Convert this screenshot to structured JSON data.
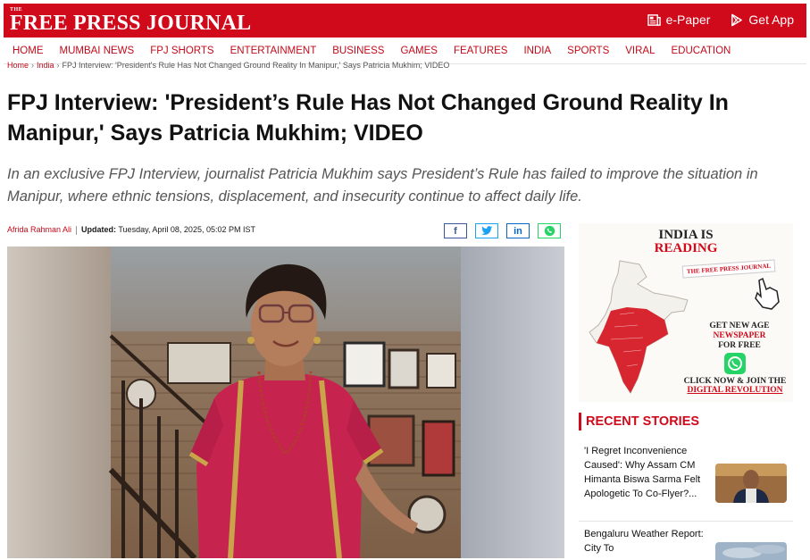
{
  "header": {
    "logo_the": "THE",
    "logo_name": "FREE PRESS JOURNAL",
    "epaper_label": "e-Paper",
    "getapp_label": "Get App"
  },
  "nav": {
    "items": [
      "HOME",
      "MUMBAI NEWS",
      "FPJ SHORTS",
      "ENTERTAINMENT",
      "BUSINESS",
      "GAMES",
      "FEATURES",
      "INDIA",
      "SPORTS",
      "VIRAL",
      "EDUCATION"
    ]
  },
  "breadcrumb": {
    "items": [
      "Home",
      "India",
      "FPJ Interview: 'President's Rule Has Not Changed Ground Reality In Manipur,' Says Patricia Mukhim; VIDEO"
    ]
  },
  "article": {
    "headline": "FPJ Interview: 'President’s Rule Has Not Changed Ground Reality In Manipur,' Says Patricia Mukhim; VIDEO",
    "summary": "In an exclusive FPJ Interview, journalist Patricia Mukhim says President’s Rule has failed to improve the situation in Manipur, where ethnic tensions, displacement, and insecurity continue to affect daily life.",
    "author": "Afrida Rahman Ali",
    "updated_label": "Updated:",
    "updated_value": "Tuesday, April 08, 2025, 05:02 PM IST"
  },
  "share": {
    "facebook": "f",
    "twitter": "twitter-bird-icon",
    "linkedin": "in",
    "whatsapp": "whatsapp-icon"
  },
  "ad": {
    "title_line1": "INDIA IS",
    "title_line2": "READING",
    "paper_name": "THE FREE PRESS JOURNAL",
    "line_get": "GET NEW AGE",
    "line_newspaper": "NEWSPAPER",
    "line_free": "FOR FREE",
    "cta_line1": "CLICK NOW & JOIN THE",
    "cta_line2": "DIGITAL REVOLUTION"
  },
  "recent": {
    "heading": "RECENT STORIES",
    "stories": [
      {
        "title": "'I Regret Inconvenience Caused': Why Assam CM Himanta Biswa Sarma Felt Apologetic To Co-Flyer?..."
      },
      {
        "title": "Bengaluru Weather Report: City To"
      }
    ]
  },
  "colors": {
    "brand_red": "#d0091b",
    "link_red": "#c20a1a"
  }
}
